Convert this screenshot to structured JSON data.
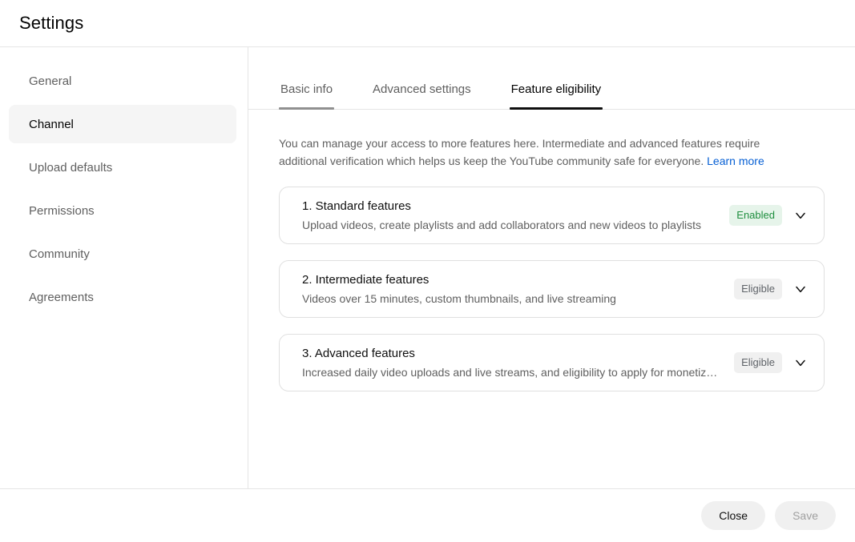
{
  "header": {
    "title": "Settings"
  },
  "sidebar": {
    "items": [
      {
        "label": "General",
        "selected": false
      },
      {
        "label": "Channel",
        "selected": true
      },
      {
        "label": "Upload defaults",
        "selected": false
      },
      {
        "label": "Permissions",
        "selected": false
      },
      {
        "label": "Community",
        "selected": false
      },
      {
        "label": "Agreements",
        "selected": false
      }
    ]
  },
  "tabs": [
    {
      "label": "Basic info",
      "state": "hovered"
    },
    {
      "label": "Advanced settings",
      "state": "default"
    },
    {
      "label": "Feature eligibility",
      "state": "active"
    }
  ],
  "panel": {
    "intro_text": "You can manage your access to more features here. Intermediate and advanced features require additional verification which helps us keep the YouTube community safe for everyone. ",
    "intro_link": "Learn more",
    "features": [
      {
        "title": "1. Standard features",
        "description": "Upload videos, create playlists and add collaborators and new videos to playlists",
        "badge": "Enabled",
        "badge_type": "enabled"
      },
      {
        "title": "2. Intermediate features",
        "description": "Videos over 15 minutes, custom thumbnails, and live streaming",
        "badge": "Eligible",
        "badge_type": "eligible"
      },
      {
        "title": "3. Advanced features",
        "description": "Increased daily video uploads and live streams, and eligibility to apply for monetization",
        "badge": "Eligible",
        "badge_type": "eligible"
      }
    ]
  },
  "footer": {
    "close_label": "Close",
    "save_label": "Save"
  },
  "colors": {
    "accent_link": "#065fd4",
    "badge_enabled_bg": "#e6f4ea",
    "badge_enabled_fg": "#1e8e3e",
    "badge_eligible_bg": "#f0f0f0",
    "badge_eligible_fg": "#5f6368",
    "active_tab_underline": "#0f0f0f",
    "hover_tab_underline": "#909090"
  }
}
